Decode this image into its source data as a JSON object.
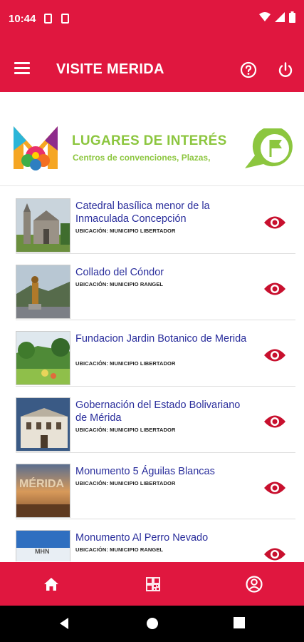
{
  "status_bar": {
    "time": "10:44",
    "icons": [
      "sim-card-icon",
      "image-icon",
      "wifi-icon",
      "signal-icon",
      "battery-icon"
    ]
  },
  "app_bar": {
    "title": "VISITE MERIDA",
    "icons": [
      "menu-icon",
      "help-icon",
      "power-icon"
    ]
  },
  "banner": {
    "title": "LUGARES DE INTERÉS",
    "subtitle": "Centros de convenciones, Plazas,",
    "icons": [
      "merida-logo",
      "location-flag-icon"
    ]
  },
  "places": [
    {
      "name": "Catedral basílica menor de la Inmaculada Concepción",
      "location": "UBICACIÓN: MUNICIPIO LIBERTADOR"
    },
    {
      "name": "Collado del Cóndor",
      "location": "UBICACIÓN: MUNICIPIO RANGEL"
    },
    {
      "name": "Fundacion Jardin Botanico de Merida",
      "location": "UBICACIÓN: MUNICIPIO LIBERTADOR"
    },
    {
      "name": "Gobernación del Estado Bolivariano de Mérida",
      "location": "UBICACIÓN: MUNICIPIO LIBERTADOR"
    },
    {
      "name": "Monumento 5 Águilas Blancas",
      "location": "UBICACIÓN: MUNICIPIO LIBERTADOR"
    },
    {
      "name": "Monumento Al Perro Nevado",
      "location": "UBICACIÓN: MUNICIPIO RANGEL"
    }
  ],
  "place_thumb_text": {
    "aguilas": "MÉRIDA",
    "perro": "MHN"
  },
  "bottom_nav": {
    "icons": [
      "home-icon",
      "qr-code-icon",
      "account-icon"
    ]
  },
  "colors": {
    "primary": "#e0173f",
    "title_text": "#2a2e9c",
    "accent_green": "#8cc63f",
    "eye": "#c8102e"
  }
}
